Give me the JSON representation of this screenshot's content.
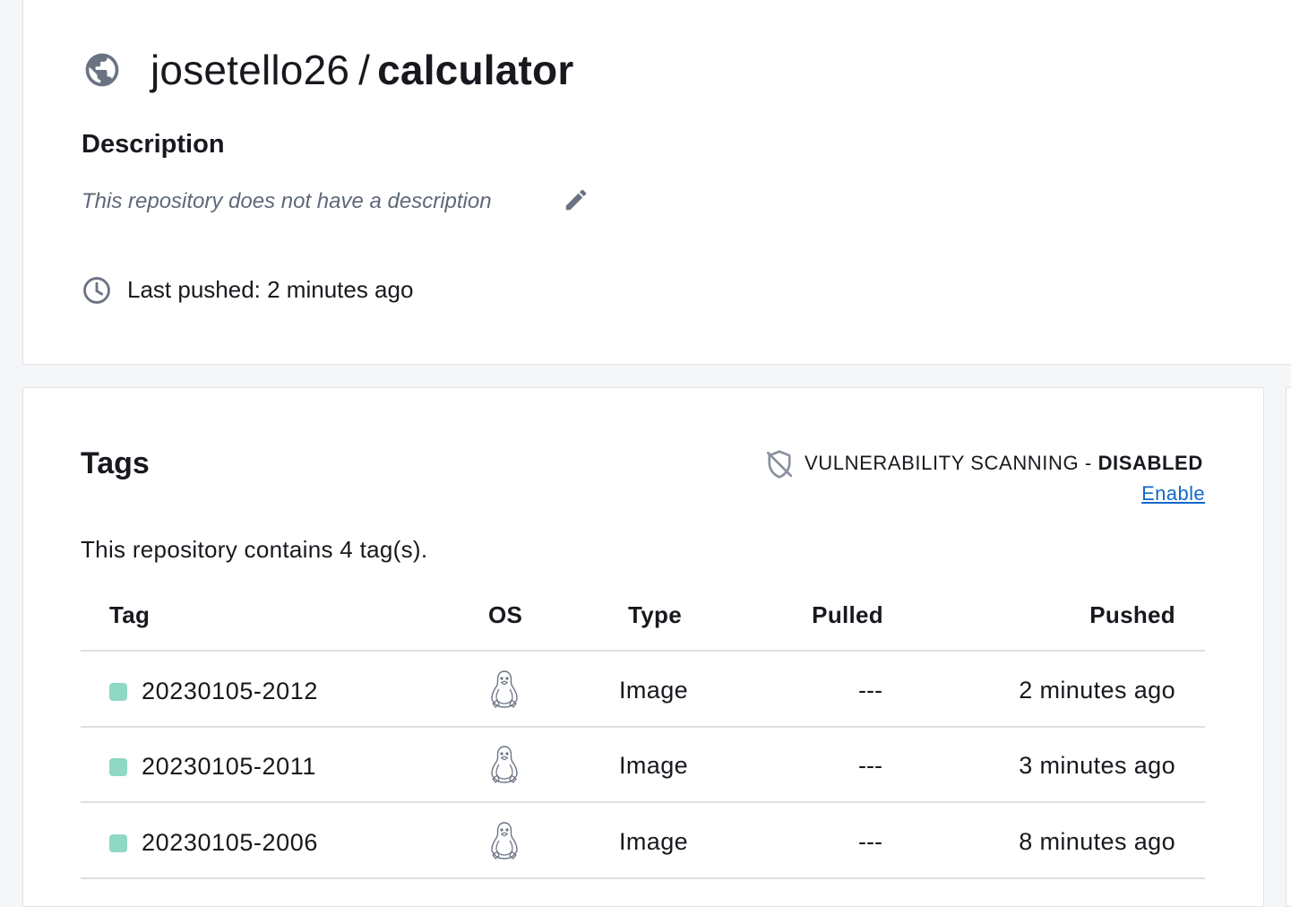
{
  "repo": {
    "namespace": "josetello26",
    "separator": "/",
    "name": "calculator",
    "visibility_icon": "globe-icon",
    "description_heading": "Description",
    "description_text": "This repository does not have a description",
    "edit_icon": "pencil-icon",
    "last_pushed": "Last pushed: 2 minutes ago",
    "clock_icon": "clock-icon"
  },
  "tags_section": {
    "heading": "Tags",
    "vuln_label": "VULNERABILITY SCANNING - ",
    "vuln_status": "DISABLED",
    "enable_link": "Enable",
    "count_text": "This repository contains 4 tag(s).",
    "columns": {
      "tag": "Tag",
      "os": "OS",
      "type": "Type",
      "pulled": "Pulled",
      "pushed": "Pushed"
    },
    "rows": [
      {
        "tag": "20230105-2012",
        "os_icon": "linux-tux-icon",
        "type": "Image",
        "pulled": "---",
        "pushed": "2 minutes ago"
      },
      {
        "tag": "20230105-2011",
        "os_icon": "linux-tux-icon",
        "type": "Image",
        "pulled": "---",
        "pushed": "3 minutes ago"
      },
      {
        "tag": "20230105-2006",
        "os_icon": "linux-tux-icon",
        "type": "Image",
        "pulled": "---",
        "pushed": "8 minutes ago"
      }
    ]
  },
  "colors": {
    "background": "#f5f6f8",
    "card": "#ffffff",
    "link": "#1467c8",
    "tag_status": "#8ed8c4",
    "muted_text": "#5f6878"
  }
}
